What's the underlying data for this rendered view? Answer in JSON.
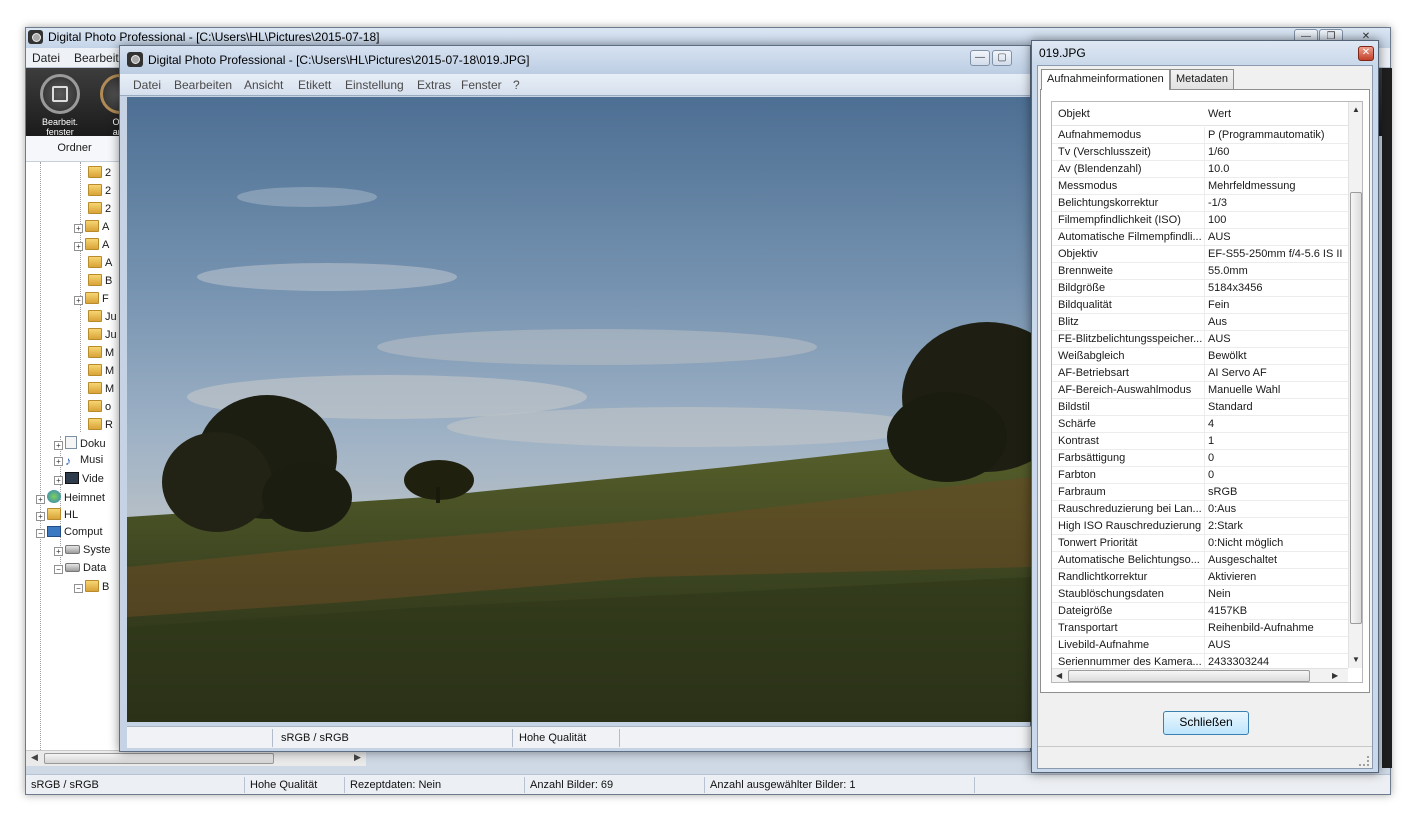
{
  "main_window": {
    "title": "Digital Photo Professional - [C:\\Users\\HL\\Pictures\\2015-07-18]",
    "menu": [
      "Datei",
      "Bearbeit"
    ],
    "toolbar": [
      {
        "label_1": "Bearbeit.",
        "label_2": "fenster"
      },
      {
        "label_1": "Ord",
        "label_2": "ans"
      }
    ],
    "folder_panel_header": "Ordner",
    "tree": [
      {
        "label": "2"
      },
      {
        "label": "2"
      },
      {
        "label": "2"
      },
      {
        "label": "A"
      },
      {
        "label": "A"
      },
      {
        "label": "A"
      },
      {
        "label": "B"
      },
      {
        "label": "F"
      },
      {
        "label": "Ju"
      },
      {
        "label": "Ju"
      },
      {
        "label": "M"
      },
      {
        "label": "M"
      },
      {
        "label": "M"
      },
      {
        "label": "o"
      },
      {
        "label": "R"
      },
      {
        "label": "Doku"
      },
      {
        "label": "Musi"
      },
      {
        "label": "Vide"
      },
      {
        "label": "Heimnet"
      },
      {
        "label": "HL"
      },
      {
        "label": "Comput"
      },
      {
        "label": "Syste"
      },
      {
        "label": "Data"
      },
      {
        "label": "B"
      }
    ],
    "status": {
      "color_space": "sRGB / sRGB",
      "quality": "Hohe Qualität",
      "recipe": "Rezeptdaten: Nein",
      "count": "Anzahl Bilder: 69",
      "selected": "Anzahl ausgewählter Bilder: 1"
    }
  },
  "photo_window": {
    "title": "Digital Photo Professional - [C:\\Users\\HL\\Pictures\\2015-07-18\\019.JPG]",
    "menu": [
      "Datei",
      "Bearbeiten",
      "Ansicht",
      "Etikett",
      "Einstellung",
      "Extras",
      "Fenster",
      "?"
    ],
    "status": {
      "color_space": "sRGB / sRGB",
      "quality": "Hohe Qualität"
    }
  },
  "info_dialog": {
    "title": "019.JPG",
    "tabs": [
      "Aufnahmeinformationen",
      "Metadaten"
    ],
    "active_tab": 0,
    "columns": [
      "Objekt",
      "Wert"
    ],
    "rows": [
      [
        "Aufnahmemodus",
        "P (Programmautomatik)"
      ],
      [
        "Tv (Verschlusszeit)",
        "1/60"
      ],
      [
        "Av (Blendenzahl)",
        "10.0"
      ],
      [
        "Messmodus",
        "Mehrfeldmessung"
      ],
      [
        "Belichtungskorrektur",
        "-1/3"
      ],
      [
        "Filmempfindlichkeit (ISO)",
        "100"
      ],
      [
        "Automatische Filmempfindli...",
        "AUS"
      ],
      [
        "Objektiv",
        "EF-S55-250mm f/4-5.6 IS II"
      ],
      [
        "Brennweite",
        "55.0mm"
      ],
      [
        "Bildgröße",
        "5184x3456"
      ],
      [
        "Bildqualität",
        "Fein"
      ],
      [
        "Blitz",
        "Aus"
      ],
      [
        "FE-Blitzbelichtungsspeicher...",
        "AUS"
      ],
      [
        "Weißabgleich",
        "Bewölkt"
      ],
      [
        "AF-Betriebsart",
        "AI Servo AF"
      ],
      [
        "AF-Bereich-Auswahlmodus",
        "Manuelle  Wahl"
      ],
      [
        "Bildstil",
        "Standard"
      ],
      [
        "Schärfe",
        "4"
      ],
      [
        "Kontrast",
        "1"
      ],
      [
        "Farbsättigung",
        "0"
      ],
      [
        "Farbton",
        "0"
      ],
      [
        "Farbraum",
        "sRGB"
      ],
      [
        "Rauschreduzierung bei Lan...",
        "0:Aus"
      ],
      [
        "High ISO Rauschreduzierung",
        "2:Stark"
      ],
      [
        "Tonwert Priorität",
        "0:Nicht möglich"
      ],
      [
        "Automatische Belichtungso...",
        "Ausgeschaltet"
      ],
      [
        "Randlichtkorrektur",
        "Aktivieren"
      ],
      [
        "Staublöschungsdaten",
        "Nein"
      ],
      [
        "Dateigröße",
        "4157KB"
      ],
      [
        "Transportart",
        "Reihenbild-Aufnahme"
      ],
      [
        "Livebild-Aufnahme",
        "AUS"
      ],
      [
        "Seriennummer des Kamera...",
        "2433303244"
      ]
    ],
    "close_button": "Schließen",
    "colors": {
      "button_border": "#3c7fb1",
      "close_red": "#c2402a"
    }
  }
}
